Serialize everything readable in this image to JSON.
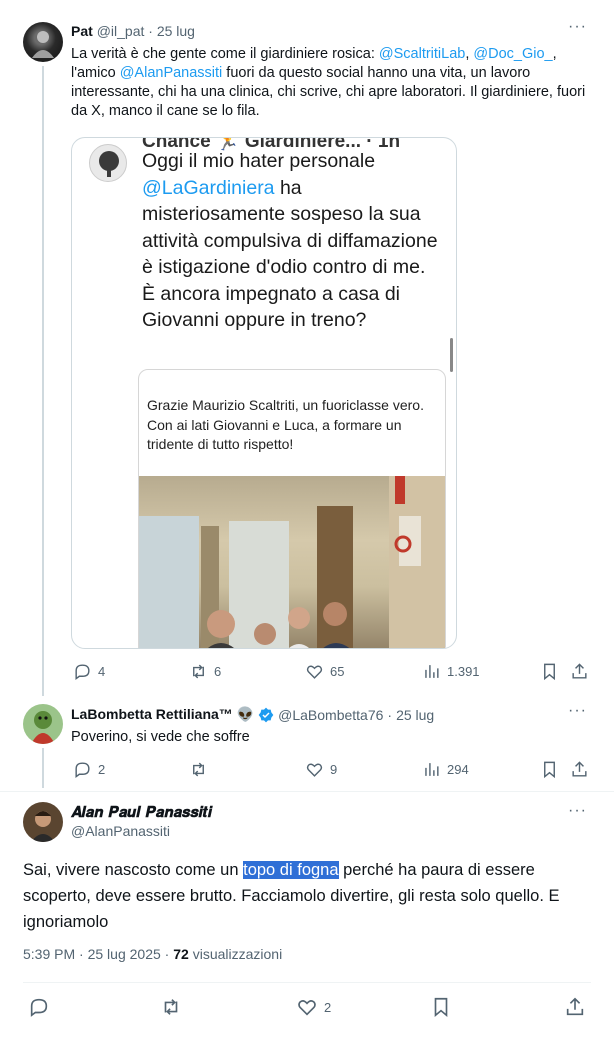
{
  "tweet1": {
    "name": "Pat",
    "handle": "@il_pat",
    "sep": "·",
    "date": "25 lug",
    "text_1": "La verità è che gente come il giardiniere rosica: ",
    "mention_1": "@ScaltritiLab",
    "text_2": ", ",
    "mention_2": "@Doc_Gio_",
    "text_3": ", l'amico ",
    "mention_3": "@AlanPanassiti",
    "text_4": " fuori da questo social hanno una vita, un lavoro interessante, chi ha una clinica, chi scrive, chi apre laboratori. Il giardiniere, fuori da X, manco il cane se lo fila.",
    "embed": {
      "cut_top": "Chance 🏃 Giardiniere... · 1h",
      "text_a": "Oggi il mio hater personale ",
      "mention": "@LaGardiniera",
      "text_b": " ha misteriosamente sospeso la sua attività compulsiva di diffamazione è istigazione d'odio contro di me. È ancora impegnato a casa di Giovanni oppure in treno?",
      "quote_text": "Grazie Maurizio Scaltriti, un fuoriclasse vero.\nCon ai lati Giovanni e Luca, a formare un tridente di tutto rispetto!"
    },
    "stats": {
      "replies": "4",
      "reposts": "6",
      "likes": "65",
      "views": "1.391"
    }
  },
  "tweet2": {
    "name": "LaBombetta Rettiliana™ 👽",
    "handle": "@LaBombetta76",
    "sep": "·",
    "date": "25 lug",
    "text": "Poverino, si vede che soffre",
    "stats": {
      "replies": "2",
      "reposts": "",
      "likes": "9",
      "views": "294"
    }
  },
  "main": {
    "name": "𝑨𝒍𝒂𝒏 𝑷𝒂𝒖𝒍 𝑷𝒂𝒏𝒂𝒔𝒔𝒊𝒕𝒊",
    "handle": "@AlanPanassiti",
    "text_1": "Sai, vivere nascosto come un ",
    "highlight": "topo di fogna",
    "text_2": " perché ha paura di essere scoperto, deve essere brutto. Facciamolo divertire, gli resta solo quello. E ignoriamolo",
    "time": "5:39 PM",
    "dot": "·",
    "date": "25 lug 2025",
    "views_count": "72",
    "views_label": "visualizzazioni",
    "likes": "2"
  },
  "more_label": "···",
  "colors": {
    "accent": "#1d9bf0",
    "muted": "#536471",
    "highlight": "#2f6fd6",
    "divider": "#eff3f4"
  }
}
